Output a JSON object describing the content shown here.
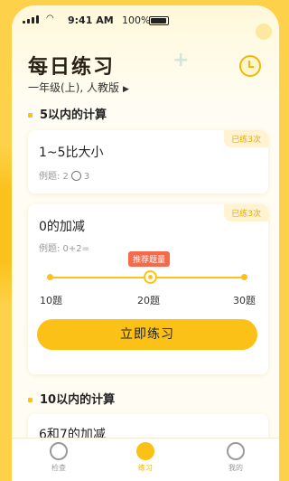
{
  "status_bar": {
    "time": "9:41 AM",
    "battery": "100%"
  },
  "header": {
    "title": "每日练习",
    "grade": "一年级(上), 人教版",
    "grade_arrow": "▶"
  },
  "sections": [
    {
      "title": "5以内的计算"
    },
    {
      "title": "10以内的计算"
    }
  ],
  "cards": [
    {
      "title": "1~5比大小",
      "example_prefix": "例题: 2",
      "example_suffix": "3",
      "done": "已练3次"
    },
    {
      "title": "0的加减",
      "example": "例题: 0+2=",
      "done": "已练3次",
      "recommend": "推荐题量",
      "ticks": [
        "10题",
        "20题",
        "30题"
      ],
      "selected_count": "20题",
      "start_button": "立即练习"
    },
    {
      "title": "6和7的加减"
    }
  ],
  "tabs": [
    {
      "label": "检查",
      "active": false
    },
    {
      "label": "练习",
      "active": true
    },
    {
      "label": "我的",
      "active": false
    }
  ],
  "colors": {
    "accent": "#fcc117",
    "recommend": "#f46a4a",
    "background": "#fdd24a"
  }
}
